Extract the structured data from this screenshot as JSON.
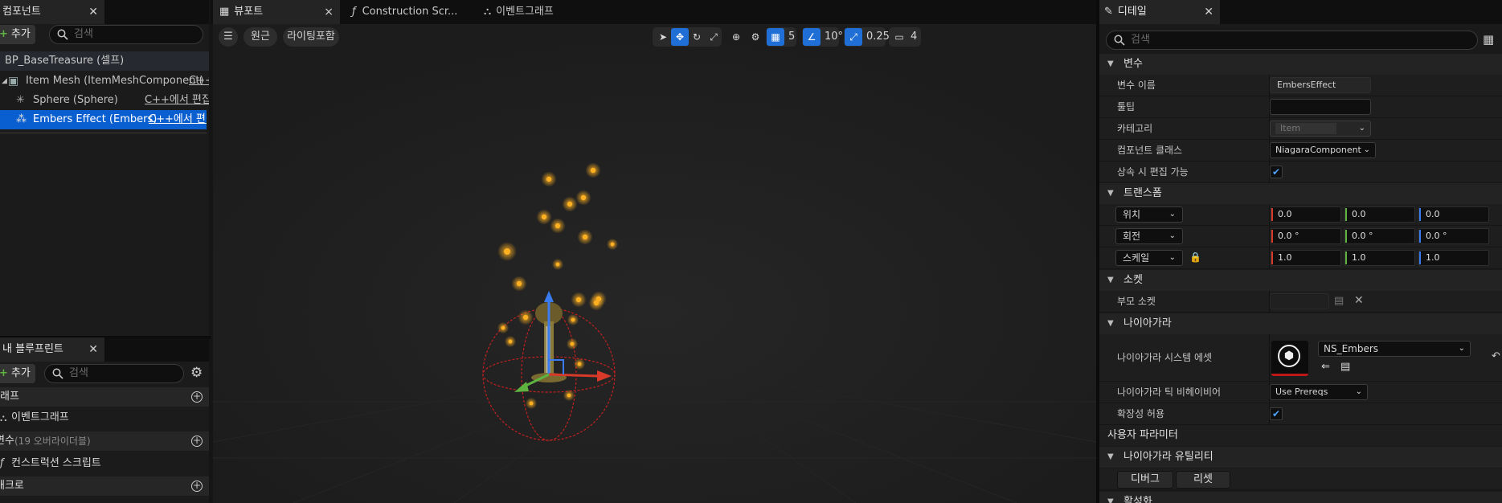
{
  "components_panel": {
    "tab_label": "컴포넌트",
    "add_label": "추가",
    "search_placeholder": "검색",
    "root": "BP_BaseTreasure (셀프)",
    "items": [
      {
        "label": "Item Mesh (ItemMeshComponent)",
        "action": "C++"
      },
      {
        "label": "Sphere (Sphere)",
        "action": "C++에서 편집"
      },
      {
        "label": "Embers Effect (Embers)",
        "action": "C++에서 편집"
      }
    ]
  },
  "my_blueprint_panel": {
    "tab_label": "내 블루프린트",
    "add_label": "추가",
    "search_placeholder": "검색",
    "sections": [
      {
        "label": "래프"
      },
      {
        "label": "이벤트그래프"
      },
      {
        "label": "변수",
        "note": "(19 오버라이더블)"
      },
      {
        "label": "컨스트럭션 스크립트"
      },
      {
        "label": "배크로"
      }
    ]
  },
  "editor_tabs": [
    {
      "label": "뷰포트",
      "close": "×"
    },
    {
      "label": "Construction Scr..."
    },
    {
      "label": "이벤트그래프"
    }
  ],
  "viewport": {
    "perspective_label": "원근",
    "lighting_label": "라이팅포함",
    "grid_snap": "5",
    "rotation_snap": "10°",
    "scale_snap": "0.25",
    "camera_speed": "4"
  },
  "details_panel": {
    "tab_label": "디테일",
    "search_placeholder": "검색",
    "sections": {
      "variable": "변수",
      "transform": "트랜스폼",
      "socket": "소켓",
      "niagara": "나이아가라",
      "user_params": "사용자 파라미터",
      "niagara_utils": "나이아가라 유틸리티",
      "activation": "활성화"
    },
    "variable_name_label": "변수 이름",
    "variable_name_value": "EmbersEffect",
    "tooltip_label": "툴팁",
    "tooltip_value": "",
    "category_label": "카테고리",
    "category_value": "Item",
    "component_class_label": "컴포넌트 클래스",
    "component_class_value": "NiagaraComponent",
    "editable_inherit_label": "상속 시 편집 가능",
    "location_label": "위치",
    "location": [
      "0.0",
      "0.0",
      "0.0"
    ],
    "rotation_label": "회전",
    "rotation": [
      "0.0 °",
      "0.0 °",
      "0.0 °"
    ],
    "scale_label": "스케일",
    "scale": [
      "1.0",
      "1.0",
      "1.0"
    ],
    "parent_socket_label": "부모 소켓",
    "niagara_asset_label": "나이아가라 시스템 에셋",
    "niagara_asset_value": "NS_Embers",
    "tick_behavior_label": "나이아가라 틱 비헤이비어",
    "tick_behavior_value": "Use Prereqs",
    "allow_scalability_label": "확장성 허용",
    "debug_label": "디버그",
    "reset_label": "리셋"
  },
  "colors": {
    "accent": "#1f6fd6",
    "selection": "#0a5fd0",
    "axis_x": "#d83a2a",
    "axis_y": "#5fb341",
    "axis_z": "#3a7cf0",
    "ember": "#ffb020"
  }
}
